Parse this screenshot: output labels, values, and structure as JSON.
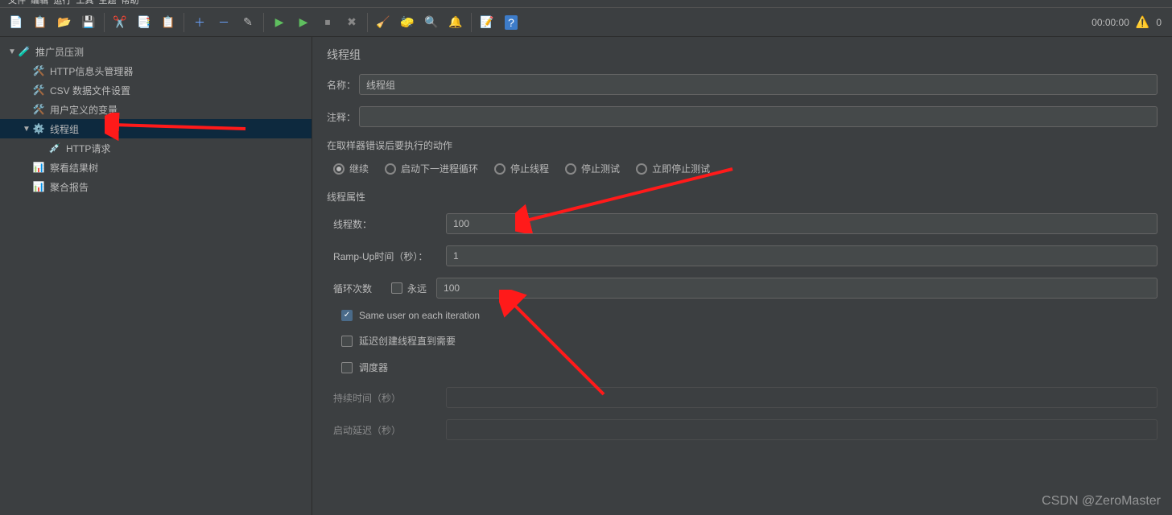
{
  "menubar_fragment": "文件  编辑  运行  工具  主题  帮助",
  "toolbar_right": {
    "time": "00:00:00",
    "warn_count": "0"
  },
  "tree": {
    "root": "推广员压测",
    "items": [
      {
        "label": "HTTP信息头管理器",
        "icon": "wrench"
      },
      {
        "label": "CSV 数据文件设置",
        "icon": "wrench"
      },
      {
        "label": "用户定义的变量",
        "icon": "wrench"
      },
      {
        "label": "线程组",
        "icon": "gear",
        "selected": true
      },
      {
        "label": "HTTP请求",
        "icon": "pipette",
        "indent": true
      },
      {
        "label": "察看结果树",
        "icon": "report"
      },
      {
        "label": "聚合报告",
        "icon": "report"
      }
    ]
  },
  "panel": {
    "title": "线程组",
    "name_label": "名称：",
    "name_value": "线程组",
    "comment_label": "注释：",
    "comment_value": "",
    "error_action_title": "在取样器错误后要执行的动作",
    "radios": [
      "继续",
      "启动下一进程循环",
      "停止线程",
      "停止测试",
      "立即停止测试"
    ],
    "radio_selected": 0,
    "props_title": "线程属性",
    "threads_label": "线程数：",
    "threads_value": "100",
    "ramp_label": "Ramp-Up时间（秒）：",
    "ramp_value": "1",
    "loop_label": "循环次数",
    "forever_label": "永远",
    "loop_value": "100",
    "same_user_label": "Same user on each iteration",
    "delay_create_label": "延迟创建线程直到需要",
    "scheduler_label": "调度器",
    "duration_label": "持续时间（秒）",
    "startup_delay_label": "启动延迟（秒）"
  },
  "watermark": "CSDN @ZeroMaster"
}
